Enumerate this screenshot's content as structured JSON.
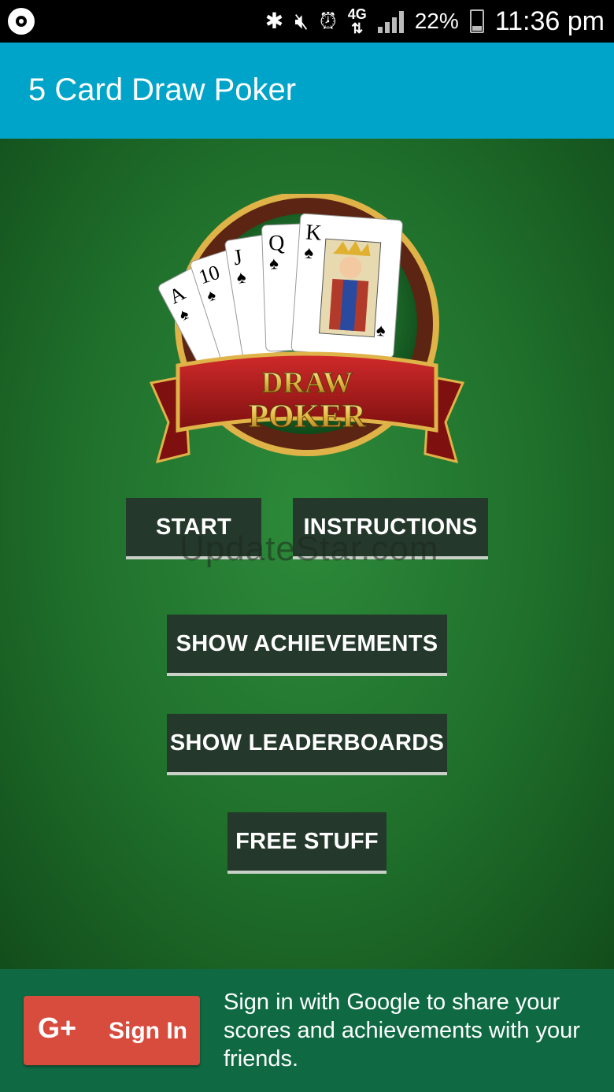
{
  "status_bar": {
    "network": "4G",
    "battery": "22%",
    "time": "11:36 pm",
    "icons": [
      "app-notification-icon",
      "bluetooth-icon",
      "mute-icon",
      "alarm-icon",
      "network-4g-icon",
      "signal-icon",
      "battery-icon"
    ]
  },
  "app_bar": {
    "title": "5 Card Draw Poker"
  },
  "logo": {
    "line1": "DRAW",
    "line2": "POKER",
    "cards": [
      "A",
      "10",
      "J",
      "Q",
      "K"
    ]
  },
  "menu": {
    "start": "START",
    "instructions": "INSTRUCTIONS",
    "achievements": "SHOW ACHIEVEMENTS",
    "leaderboards": "SHOW LEADERBOARDS",
    "free_stuff": "FREE STUFF"
  },
  "watermark": "UpdateStar.com",
  "footer": {
    "google_icon": "G+",
    "sign_in_label": "Sign In",
    "message": "Sign in with Google to share your scores and achievements with your friends."
  },
  "colors": {
    "app_bar": "#00a4c8",
    "table_felt": "#1f6f2b",
    "button": "#24392b",
    "google_red": "#d84c3e",
    "footer": "#0f6a43"
  }
}
